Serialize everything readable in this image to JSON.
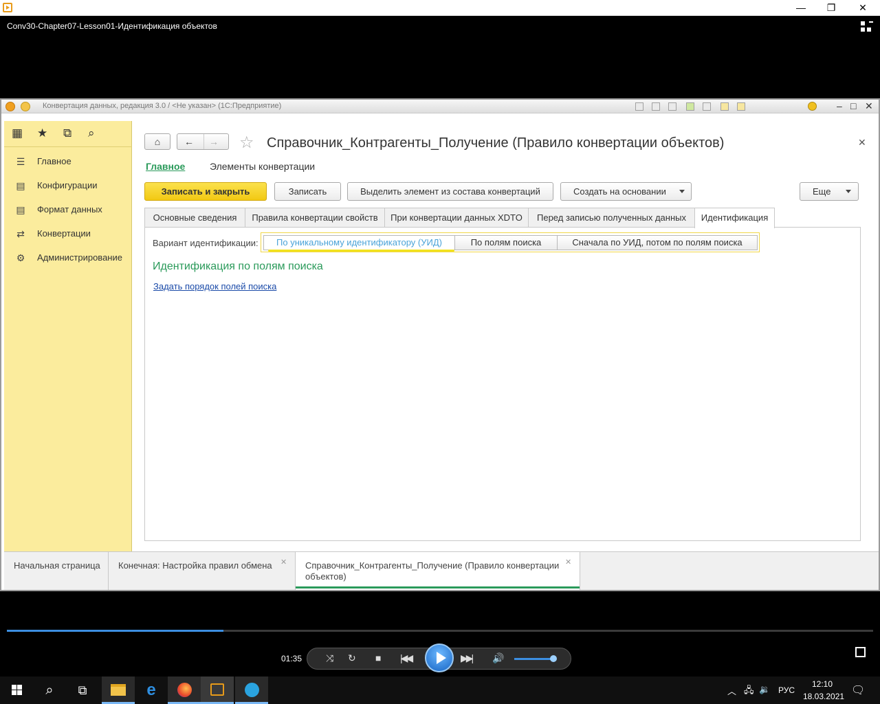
{
  "player": {
    "video_title": "Conv30-Chapter07-Lesson01-Идентификация объектов",
    "minimize": "—",
    "maximize": "❐",
    "close": "✕",
    "time": "01:35",
    "progress": 0.25,
    "volume": 0.9
  },
  "c1": {
    "window_title": "Конвертация данных, редакция 3.0 / <Не указан>  (1С:Предприятие)",
    "sidebar": {
      "items": [
        {
          "label": "Главное",
          "icon": "menu-lines-icon"
        },
        {
          "label": "Конфигурации",
          "icon": "document-icon"
        },
        {
          "label": "Формат данных",
          "icon": "document-icon"
        },
        {
          "label": "Конвертации",
          "icon": "arrows-icon"
        },
        {
          "label": "Администрирование",
          "icon": "gear-icon"
        }
      ]
    },
    "form": {
      "title": "Справочник_Контрагенты_Получение (Правило конвертации объектов)",
      "link_main": "Главное",
      "link_elements": "Элементы конвертации",
      "buttons": {
        "save_close": "Записать и закрыть",
        "save": "Записать",
        "highlight": "Выделить элемент из состава конвертаций",
        "create_based": "Создать на основании",
        "more": "Еще"
      },
      "tabs": [
        {
          "label": "Основные сведения"
        },
        {
          "label": "Правила конвертации свойств"
        },
        {
          "label": "При конвертации данных XDTO"
        },
        {
          "label": "Перед записью полученных данных"
        },
        {
          "label": "Идентификация"
        }
      ],
      "ident_label": "Вариант идентификации:",
      "ident_options": [
        "По уникальному идентификатору (УИД)",
        "По полям поиска",
        "Сначала по УИД, потом по полям поиска"
      ],
      "section_heading": "Идентификация по полям поиска",
      "set_order_link": "Задать порядок полей поиска"
    },
    "bottom_tabs": [
      {
        "label": "Начальная страница"
      },
      {
        "label": "Конечная: Настройка правил обмена"
      },
      {
        "label": "Справочник_Контрагенты_Получение (Правило конвертации объектов)"
      }
    ]
  },
  "taskbar": {
    "lang": "РУС",
    "time": "12:10",
    "date": "18.03.2021"
  }
}
